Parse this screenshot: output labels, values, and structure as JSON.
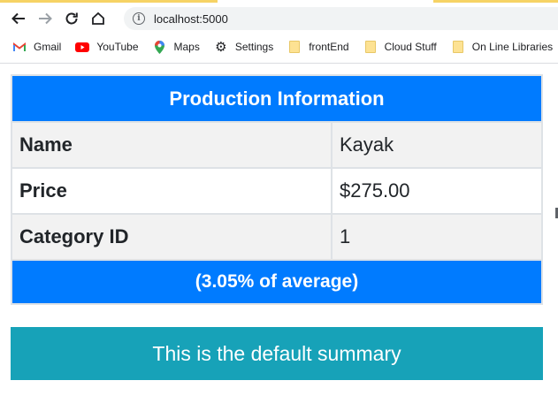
{
  "browser": {
    "url": "localhost:5000",
    "bookmarks": [
      {
        "label": "Gmail",
        "icon": "gmail-icon"
      },
      {
        "label": "YouTube",
        "icon": "youtube-icon"
      },
      {
        "label": "Maps",
        "icon": "maps-icon"
      },
      {
        "label": "Settings",
        "icon": "gear-icon"
      },
      {
        "label": "frontEnd",
        "icon": "folder-icon"
      },
      {
        "label": "Cloud Stuff",
        "icon": "folder-icon"
      },
      {
        "label": "On Line Libraries",
        "icon": "folder-icon"
      }
    ]
  },
  "table": {
    "title": "Production Information",
    "rows": [
      {
        "label": "Name",
        "value": "Kayak"
      },
      {
        "label": "Price",
        "value": "$275.00"
      },
      {
        "label": "Category ID",
        "value": "1"
      }
    ],
    "footer": "(3.05% of average)"
  },
  "summary": {
    "text": "This is the default summary"
  },
  "colors": {
    "primary": "#007bff",
    "info": "#17a2b8",
    "stripe": "#f2f2f2"
  }
}
